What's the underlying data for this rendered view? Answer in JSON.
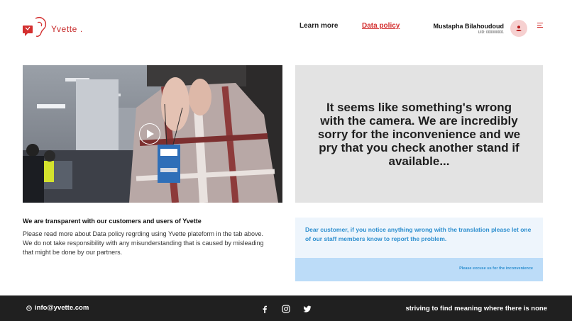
{
  "header": {
    "brand": "Yvette .",
    "nav": {
      "learn_more": "Learn more",
      "data_policy": "Data policy"
    },
    "user": {
      "name": "Mustapha Bilahoudoud",
      "uid": "UID: 000000001"
    },
    "icons": {
      "logo": "ear-logo-icon",
      "avatar": "user-icon",
      "menu": "menu-lines-icon"
    }
  },
  "camera": {
    "play_icon": "play-icon"
  },
  "error": {
    "message": "It seems like something's wrong with the camera. We are incredibly sorry for the inconvenience and we pry that you check another stand if available..."
  },
  "info": {
    "title": "We are transparent with our customers and users of Yvette",
    "body": "Please read more about Data policy regrding using Yvette plateform in the tab above. We do not take responsibility with any misunderstanding that is caused by misleading that might be done by our partners."
  },
  "notice": {
    "message": "Dear customer, if you notice anything wrong with the translation please let one of our staff members know to report the problem.",
    "sub": "Please excuse us for the inconvenience"
  },
  "footer": {
    "email": "info@yvette.com",
    "tagline": "striving to find meaning where there is none",
    "social": [
      "facebook-icon",
      "instagram-icon",
      "twitter-icon"
    ]
  },
  "colors": {
    "accent": "#d32f2f",
    "footer_bg": "#202020",
    "error_bg": "#e3e3e3",
    "notice_bg": "#eef5fc",
    "notice_bar": "#bcdcf8",
    "notice_text": "#2d8fcf"
  }
}
